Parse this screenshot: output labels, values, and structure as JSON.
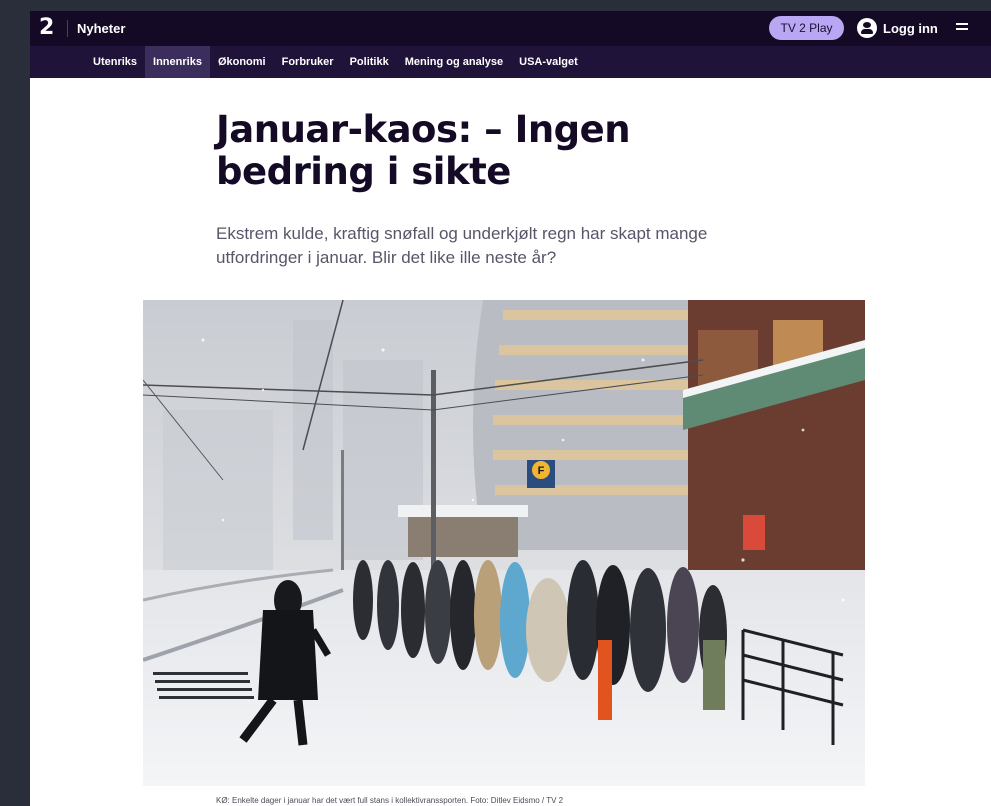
{
  "header": {
    "logo": "2",
    "section": "Nyheter",
    "play_button": "TV 2 Play",
    "login": "Logg inn"
  },
  "nav": {
    "items": [
      "Utenriks",
      "Innenriks",
      "Økonomi",
      "Forbruker",
      "Politikk",
      "Mening og analyse",
      "USA-valget"
    ],
    "active": "Innenriks"
  },
  "article": {
    "headline": "Januar-kaos: – Ingen bedring i sikte",
    "lead": "Ekstrem kulde, kraftig snøfall og underkjølt regn har skapt mange utfordringer i januar. Blir det like ille neste år?",
    "caption": "KØ: Enkelte dager i januar har det vært full stans i kollektivranssporten. Foto: Ditlev Eidsmo / TV 2",
    "photo_sign": "F"
  },
  "colors": {
    "topbar": "#140a26",
    "nav": "#20133a",
    "nav_active": "#3b2d5c",
    "play_button": "#b9a7f3"
  }
}
